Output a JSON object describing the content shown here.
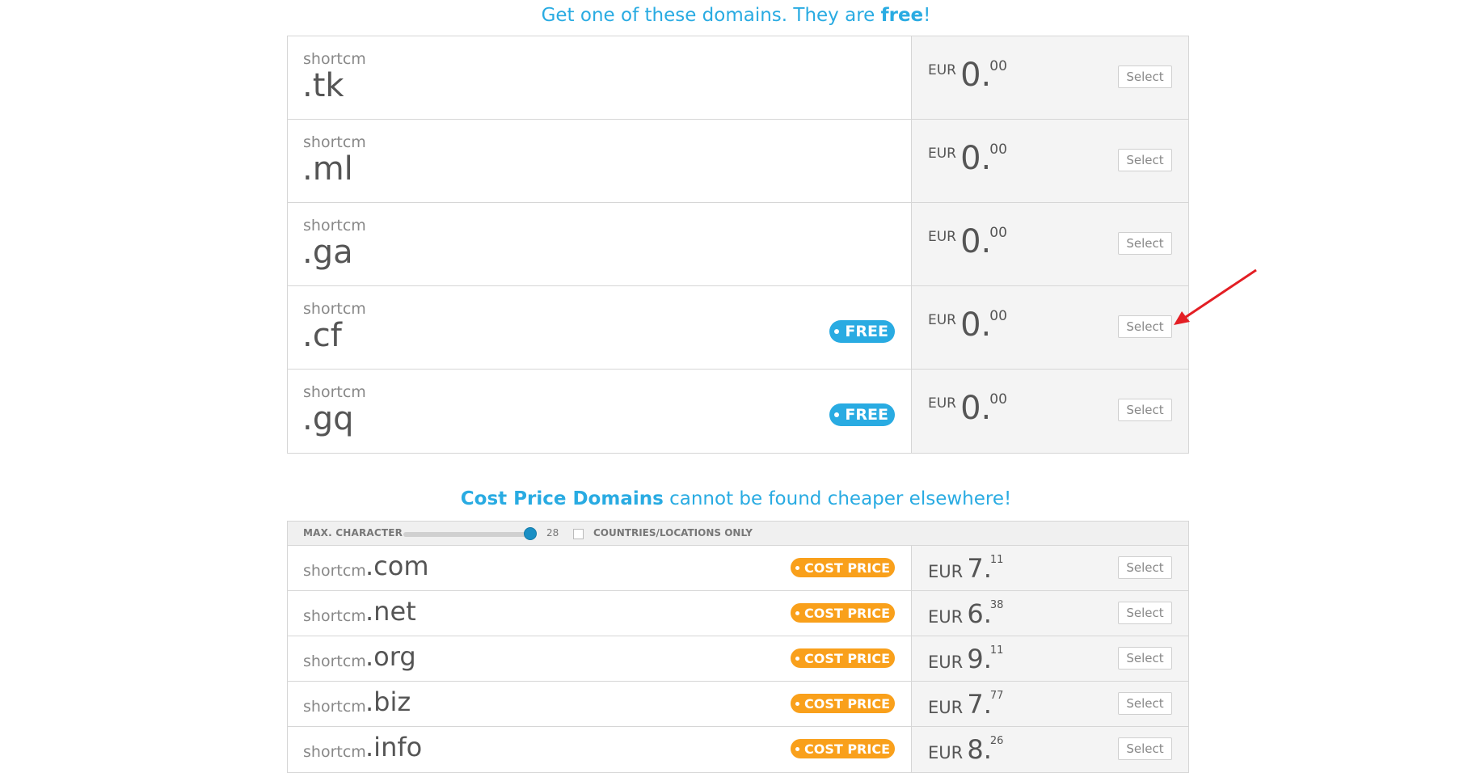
{
  "free_section": {
    "heading_prefix": "Get one of these domains. They are ",
    "heading_bold": "free",
    "heading_suffix": "!",
    "rows": [
      {
        "name": "shortcm",
        "tld": ".tk",
        "currency": "EUR",
        "price_int": "0.",
        "price_dec": "00",
        "badge": "",
        "button": "Select"
      },
      {
        "name": "shortcm",
        "tld": ".ml",
        "currency": "EUR",
        "price_int": "0.",
        "price_dec": "00",
        "badge": "",
        "button": "Select"
      },
      {
        "name": "shortcm",
        "tld": ".ga",
        "currency": "EUR",
        "price_int": "0.",
        "price_dec": "00",
        "badge": "",
        "button": "Select"
      },
      {
        "name": "shortcm",
        "tld": ".cf",
        "currency": "EUR",
        "price_int": "0.",
        "price_dec": "00",
        "badge": "FREE",
        "button": "Select"
      },
      {
        "name": "shortcm",
        "tld": ".gq",
        "currency": "EUR",
        "price_int": "0.",
        "price_dec": "00",
        "badge": "FREE",
        "button": "Select"
      }
    ]
  },
  "cost_section": {
    "heading_bold": "Cost Price Domains",
    "heading_rest": " cannot be found cheaper elsewhere!",
    "filter": {
      "max_character_label": "MAX. CHARACTER",
      "max_character_value": "28",
      "slider_level": 1.0,
      "countries_label": "COUNTRIES/LOCATIONS ONLY"
    },
    "rows": [
      {
        "name": "shortcm",
        "tld": ".com",
        "badge": "COST PRICE",
        "currency": "EUR",
        "price_int": "7.",
        "price_dec": "11",
        "button": "Select"
      },
      {
        "name": "shortcm",
        "tld": ".net",
        "badge": "COST PRICE",
        "currency": "EUR",
        "price_int": "6.",
        "price_dec": "38",
        "button": "Select"
      },
      {
        "name": "shortcm",
        "tld": ".org",
        "badge": "COST PRICE",
        "currency": "EUR",
        "price_int": "9.",
        "price_dec": "11",
        "button": "Select"
      },
      {
        "name": "shortcm",
        "tld": ".biz",
        "badge": "COST PRICE",
        "currency": "EUR",
        "price_int": "7.",
        "price_dec": "77",
        "button": "Select"
      },
      {
        "name": "shortcm",
        "tld": ".info",
        "badge": "COST PRICE",
        "currency": "EUR",
        "price_int": "8.",
        "price_dec": "26",
        "button": "Select"
      }
    ]
  },
  "colors": {
    "accent_blue": "#29abe2",
    "accent_orange": "#f9a01b",
    "annotation_arrow": "#e31e24"
  }
}
